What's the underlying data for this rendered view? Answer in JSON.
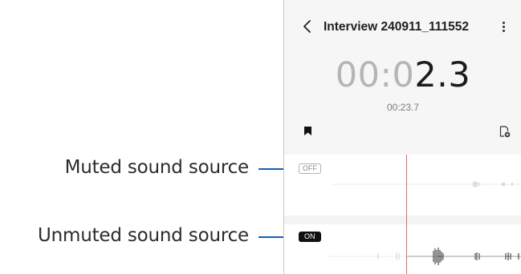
{
  "callouts": {
    "muted": "Muted sound source",
    "unmuted": "Unmuted sound source"
  },
  "header": {
    "title": "Interview 240911_111552",
    "back_icon": "chevron-left-icon",
    "more_icon": "more-vertical-icon"
  },
  "timer": {
    "elapsed_dim": "00:0",
    "elapsed_bright": "2.3",
    "total": "00:23.7"
  },
  "toolbar": {
    "bookmark_icon": "bookmark-icon",
    "add_bookmark_icon": "add-bookmark-icon"
  },
  "tracks": [
    {
      "status": "OFF"
    },
    {
      "status": "ON"
    }
  ],
  "colors": {
    "leader": "#1a5fa8",
    "playhead": "#e26a6a"
  }
}
